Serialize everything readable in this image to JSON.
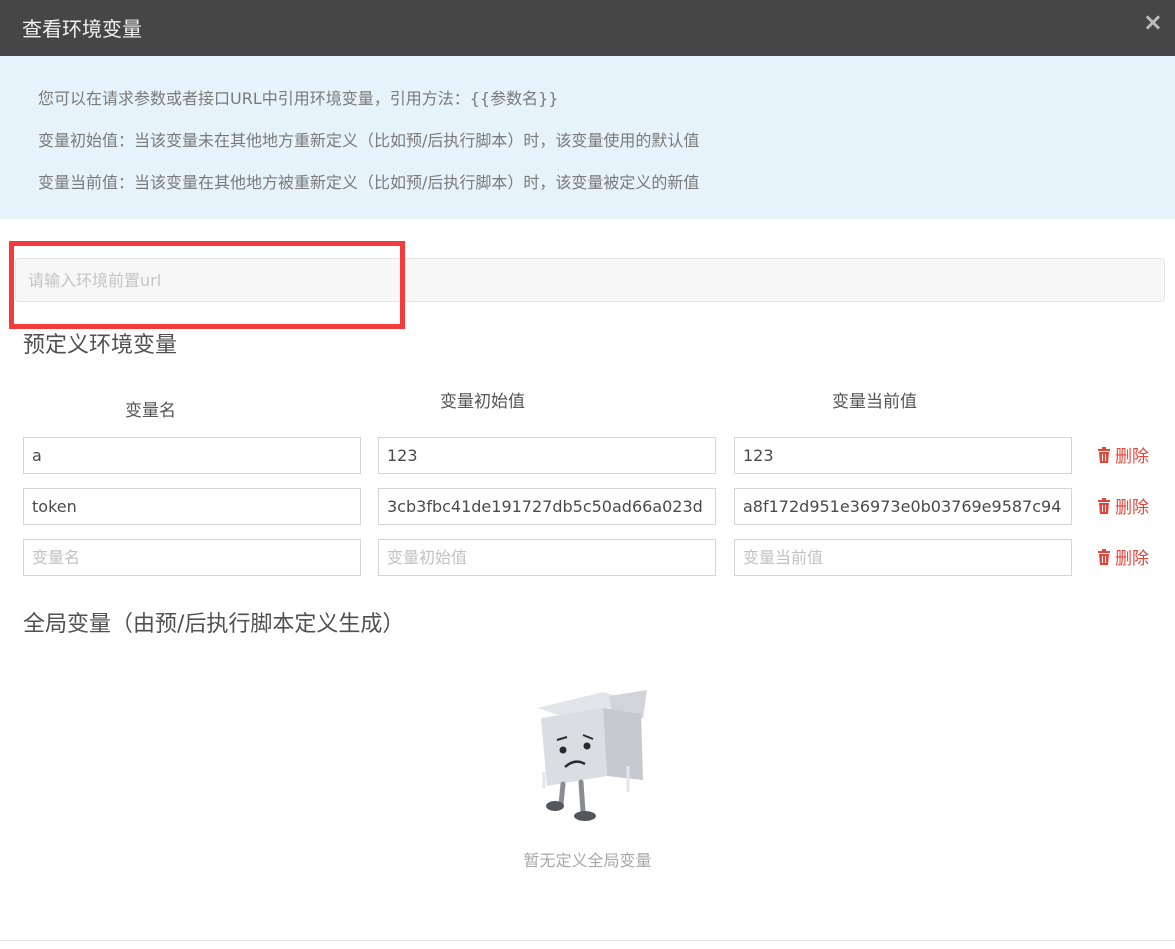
{
  "modal": {
    "title": "查看环境变量",
    "close": "×"
  },
  "info": {
    "lines": [
      "您可以在请求参数或者接口URL中引用环境变量，引用方法：{{参数名}}",
      "变量初始值：当该变量未在其他地方重新定义（比如预/后执行脚本）时，该变量使用的默认值",
      "变量当前值：当该变量在其他地方被重新定义（比如预/后执行脚本）时，该变量被定义的新值"
    ]
  },
  "url_input": {
    "placeholder": "请输入环境前置url",
    "value": ""
  },
  "predefined": {
    "title": "预定义环境变量",
    "columns": [
      "变量名",
      "变量初始值",
      "变量当前值"
    ],
    "rows": [
      {
        "name": "a",
        "initial": "123",
        "current": "123",
        "delete": "删除"
      },
      {
        "name": "token",
        "initial": "3cb3fbc41de191727db5c50ad66a023d",
        "current": "a8f172d951e36973e0b03769e9587c94",
        "delete": "删除"
      }
    ],
    "new_row": {
      "name_placeholder": "变量名",
      "initial_placeholder": "变量初始值",
      "current_placeholder": "变量当前值",
      "delete": "删除"
    }
  },
  "global": {
    "title": "全局变量（由预/后执行脚本定义生成）",
    "empty_text": "暂无定义全局变量"
  },
  "colors": {
    "header_bg": "#464646",
    "info_bg": "#e6f3fa",
    "danger": "#e2463a",
    "highlight": "#f23b3b"
  }
}
